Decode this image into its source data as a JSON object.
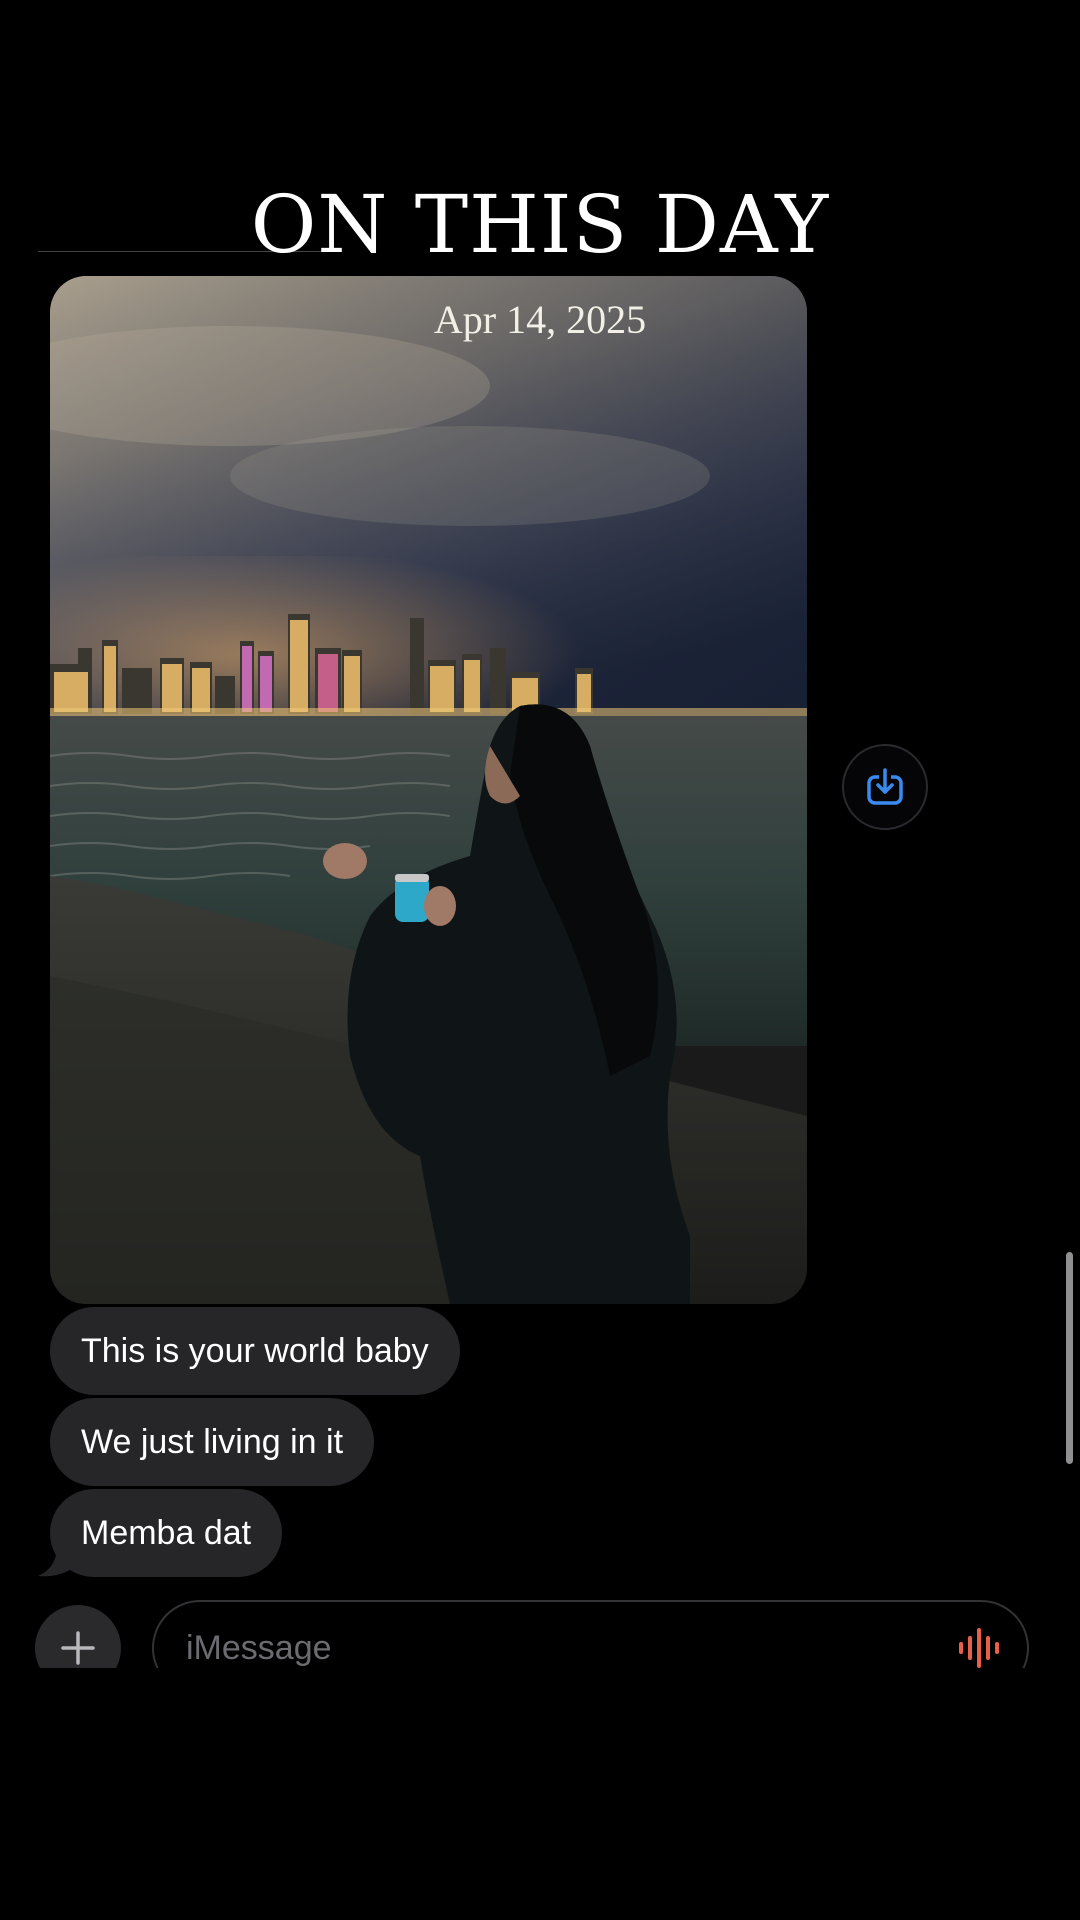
{
  "header": {
    "title": "ON THIS DAY",
    "date": "Apr 14, 2025"
  },
  "messages": [
    {
      "text": "This is your world baby"
    },
    {
      "text": "We just living in it"
    },
    {
      "text": "Memba dat"
    }
  ],
  "input": {
    "placeholder": "iMessage"
  },
  "icons": {
    "save": "save-to-photos-icon",
    "plus": "plus-icon",
    "audio": "audio-waveform-icon"
  },
  "colors": {
    "bubble": "#262628",
    "accent_blue": "#3a8bf0",
    "audio_red": "#e8604a"
  }
}
